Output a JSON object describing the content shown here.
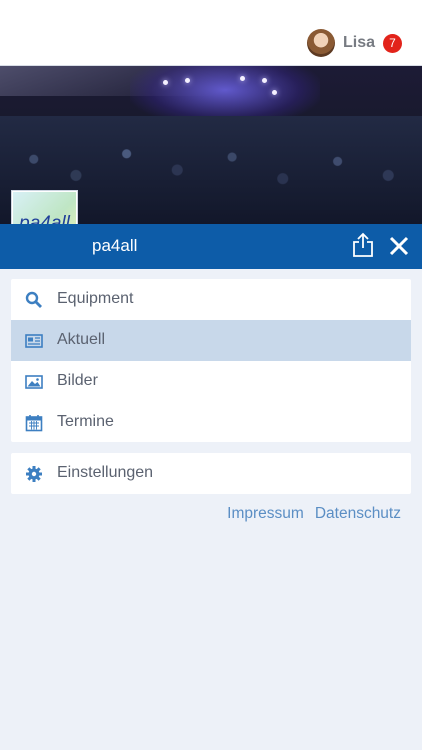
{
  "header": {
    "user_name": "Lisa",
    "notification_count": "7",
    "avatar_icon": "user-avatar"
  },
  "brand": {
    "logo_text": "pa4all",
    "app_name": "pa4all",
    "bar_color": "#0d5ca8"
  },
  "menu": {
    "items": [
      {
        "label": "Equipment",
        "icon": "search-icon",
        "active": false
      },
      {
        "label": "Aktuell",
        "icon": "newspaper-icon",
        "active": true
      },
      {
        "label": "Bilder",
        "icon": "image-icon",
        "active": false
      },
      {
        "label": "Termine",
        "icon": "calendar-icon",
        "active": false
      }
    ],
    "settings": {
      "label": "Einstellungen",
      "icon": "gear-icon"
    }
  },
  "footer": {
    "impressum": "Impressum",
    "datenschutz": "Datenschutz"
  },
  "colors": {
    "active_item": "#c8d8ea",
    "link": "#5b8ec4",
    "badge": "#e2231a",
    "background": "#edf1f8"
  }
}
